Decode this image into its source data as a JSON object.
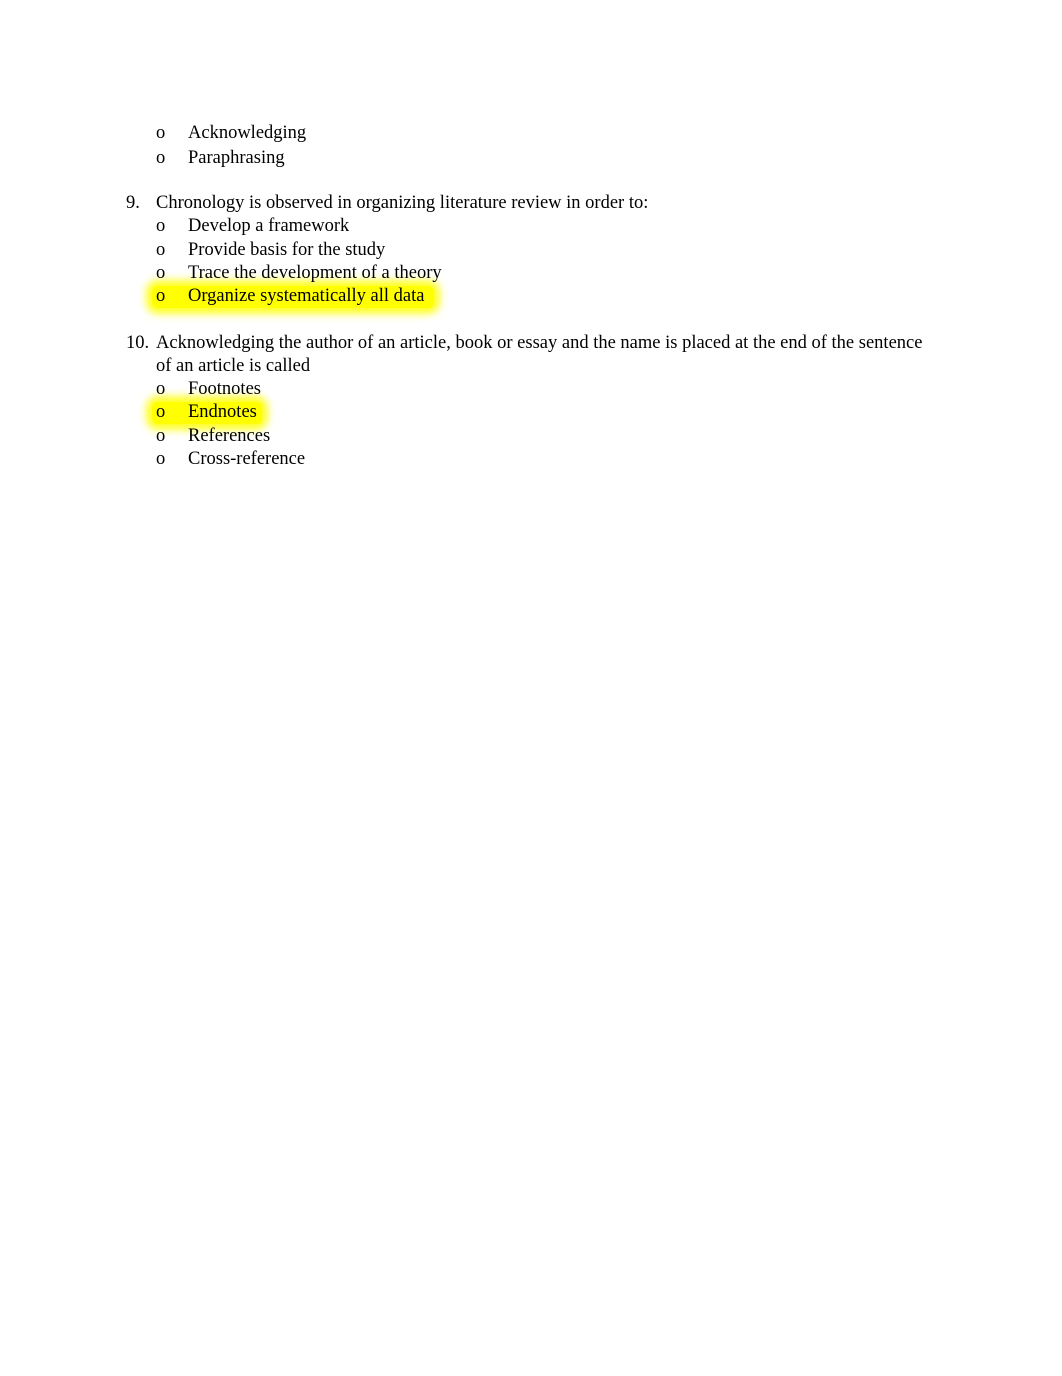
{
  "document": {
    "carryover_options": [
      {
        "marker": "o",
        "text": "Acknowledging",
        "highlighted": false
      },
      {
        "marker": "o",
        "text": "Paraphrasing",
        "highlighted": false
      }
    ],
    "questions": [
      {
        "number": "9.",
        "text_lines": [
          "Chronology is observed in organizing literature review in order to:"
        ],
        "options": [
          {
            "marker": "o",
            "text": "Develop a framework",
            "highlighted": false
          },
          {
            "marker": "o",
            "text": "Provide basis for the study",
            "highlighted": false
          },
          {
            "marker": "o",
            "text": "Trace the development of a theory",
            "highlighted": false
          },
          {
            "marker": "o",
            "text": "Organize systematically all data",
            "highlighted": true
          }
        ]
      },
      {
        "number": "10.",
        "text_lines": [
          "Acknowledging the author of an article, book or essay and the name is placed at the end of the sentence",
          "of an article is called"
        ],
        "options": [
          {
            "marker": "o",
            "text": "Footnotes",
            "highlighted": false
          },
          {
            "marker": "o",
            "text": "Endnotes",
            "highlighted": true
          },
          {
            "marker": "o",
            "text": "References",
            "highlighted": false
          },
          {
            "marker": "o",
            "text": "Cross-reference",
            "highlighted": false
          }
        ]
      }
    ],
    "highlight_color": "#FFFF00"
  }
}
